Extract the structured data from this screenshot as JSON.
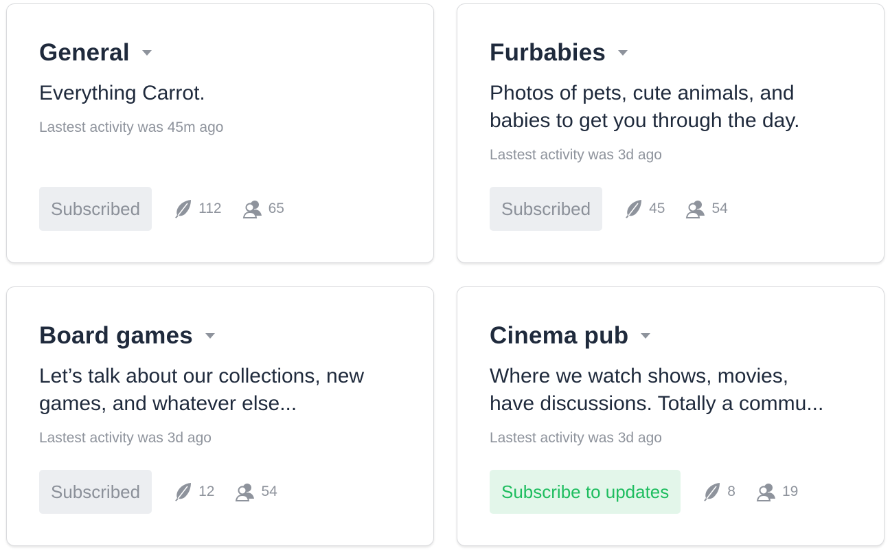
{
  "cards": [
    {
      "title": "General",
      "description": [
        "Everything Carrot."
      ],
      "activity": "Lastest activity was 45m ago",
      "button": "Subscribed",
      "button_state": "subscribed",
      "posts": "112",
      "members": "65"
    },
    {
      "title": "Furbabies",
      "description": [
        "Photos of pets, cute animals, and",
        "babies to get you through the day."
      ],
      "activity": "Lastest activity was 3d ago",
      "button": "Subscribed",
      "button_state": "subscribed",
      "posts": "45",
      "members": "54"
    },
    {
      "title": "Board games",
      "description": [
        "Let’s talk about our collections, new",
        "games, and whatever else..."
      ],
      "activity": "Lastest activity was 3d ago",
      "button": "Subscribed",
      "button_state": "subscribed",
      "posts": "12",
      "members": "54"
    },
    {
      "title": "Cinema pub",
      "description": [
        "Where we watch shows, movies,",
        "have discussions. Totally a commu..."
      ],
      "activity": "Lastest activity was 3d ago",
      "button": "Subscribe to updates",
      "button_state": "unsubscribed",
      "posts": "8",
      "members": "19"
    }
  ],
  "colors": {
    "text_primary": "#1f2a3c",
    "text_muted": "#8e939c",
    "subscribed_bg": "#eceef1",
    "subscribe_bg": "#e3f6ea",
    "subscribe_text": "#1ebd5f"
  },
  "icons": {
    "posts": "feather-icon",
    "members": "users-icon",
    "dropdown": "caret-down-icon"
  }
}
